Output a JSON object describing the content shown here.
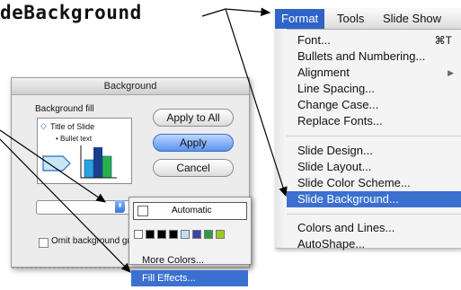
{
  "slide": {
    "title": "deBackground"
  },
  "format_menu": {
    "menubar": [
      "Format",
      "Tools",
      "Slide Show"
    ],
    "items": [
      {
        "label": "Font...",
        "shortcut": "⌘T"
      },
      {
        "label": "Bullets and Numbering..."
      },
      {
        "label": "Alignment",
        "submenu": "▶"
      },
      {
        "label": "Line Spacing..."
      },
      {
        "label": "Change Case..."
      },
      {
        "label": "Replace Fonts..."
      },
      {
        "label": "Slide Design..."
      },
      {
        "label": "Slide Layout..."
      },
      {
        "label": "Slide Color Scheme..."
      },
      {
        "label": "Slide Background..."
      },
      {
        "label": "Colors and Lines..."
      },
      {
        "label": "AutoShape..."
      }
    ]
  },
  "dialog": {
    "title": "Background",
    "fill_label": "Background fill",
    "preview_title": "Title of Slide",
    "preview_bullet": "• Bullet text",
    "apply_all": "Apply to All",
    "apply": "Apply",
    "cancel": "Cancel",
    "omit_label": "Omit background gr"
  },
  "color_popup": {
    "automatic": "Automatic",
    "more_colors": "More Colors...",
    "fill_effects": "Fill Effects...",
    "swatches": [
      "#ffffff",
      "#000000",
      "#000000",
      "#000000",
      "#bfe0f0",
      "#3a47a8",
      "#2f9a46",
      "#99cc22"
    ]
  },
  "colors": {
    "menu_highlight": "#3b70d0",
    "chart_bars": [
      "#2aa1e0",
      "#1a3f8c",
      "#28b24a"
    ]
  }
}
